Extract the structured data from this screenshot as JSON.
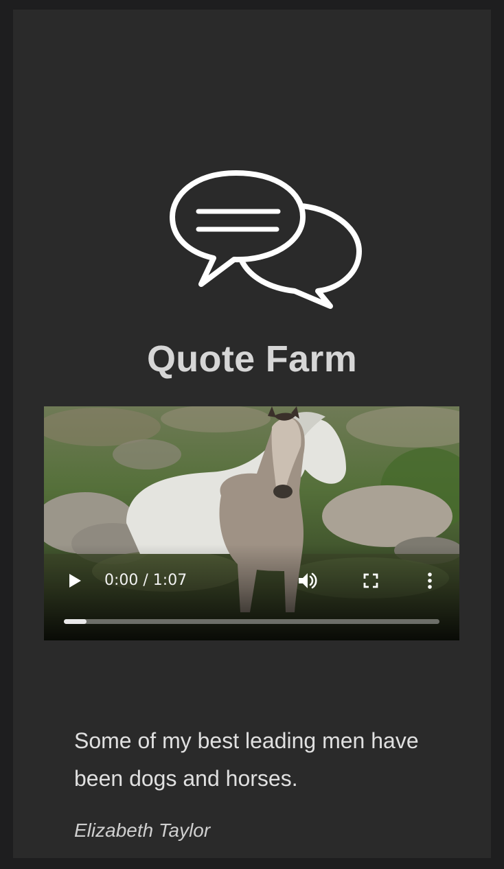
{
  "app": {
    "title": "Quote Farm",
    "logo_icon": "speech-bubbles-icon"
  },
  "video": {
    "current_time": "0:00",
    "duration": "1:07",
    "time_display": "0:00 / 1:07",
    "progress": 0.06,
    "controls": {
      "play_icon": "play-icon",
      "volume_icon": "volume-icon",
      "fullscreen_icon": "fullscreen-icon",
      "more_icon": "more-options-icon"
    }
  },
  "quote": {
    "text": "Some of my best leading men have been dogs and horses.",
    "author": "Elizabeth Taylor"
  },
  "colors": {
    "background": "#1e1e1f",
    "card": "#2a2a2a",
    "title": "#d6d6d6",
    "text": "#e0e0e0"
  }
}
